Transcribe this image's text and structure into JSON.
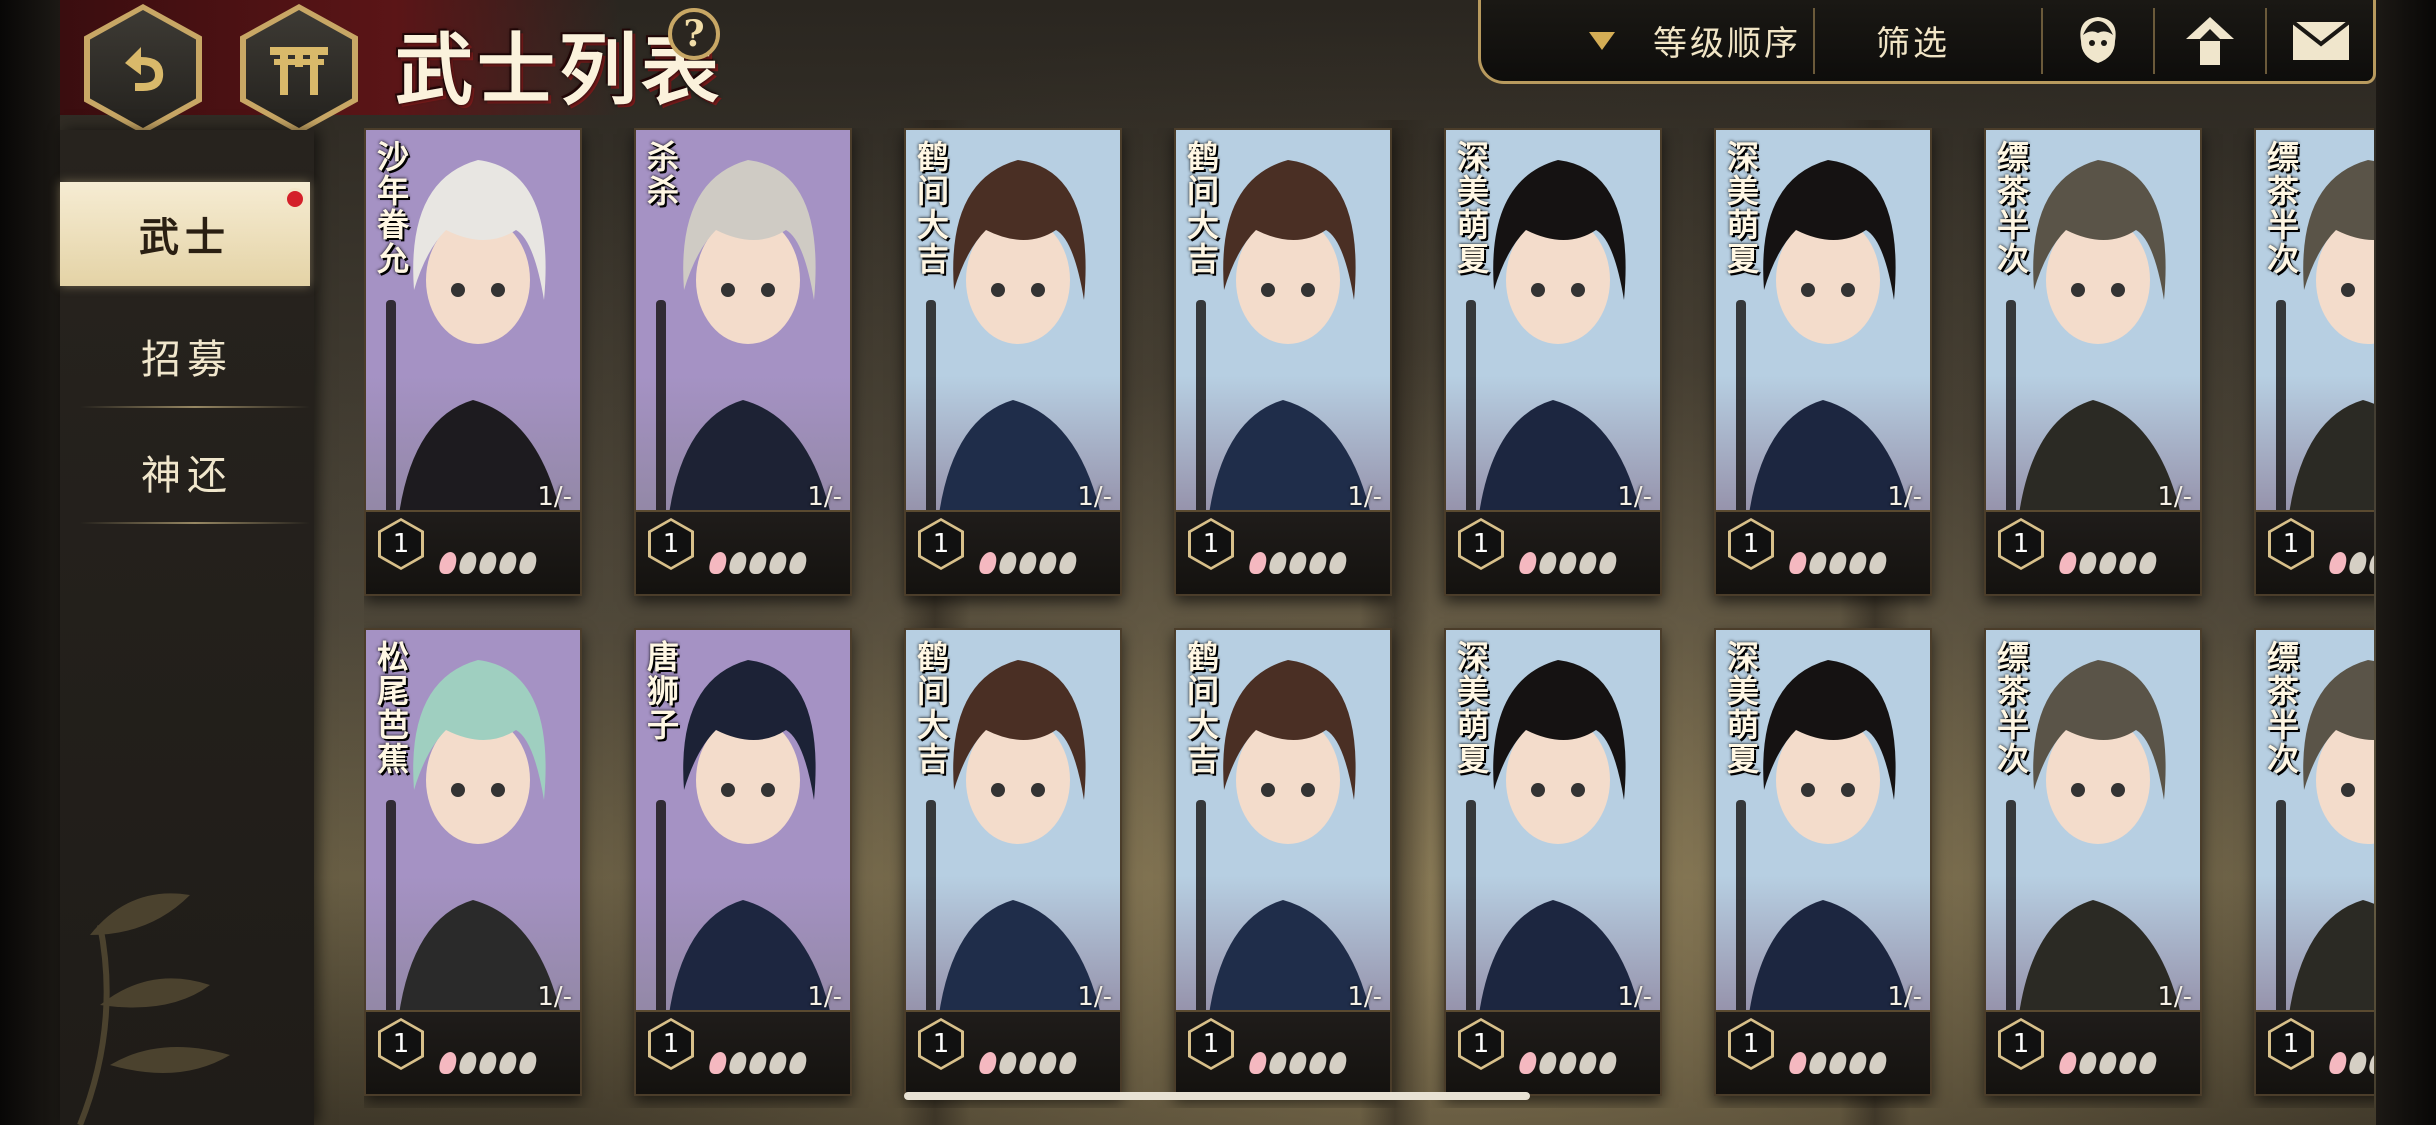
{
  "header": {
    "title": "武士列表",
    "back_icon": "back-arrow-icon",
    "home_icon": "torii-gate-icon",
    "help_label": "?"
  },
  "toolbar": {
    "sort_label": "等级顺序",
    "sort_icon": "dropdown-triangle-icon",
    "filter_label": "筛选",
    "icons": [
      "character-icon",
      "upgrade-arrow-icon",
      "mail-icon"
    ]
  },
  "sidebar": {
    "items": [
      {
        "label": "武士",
        "active": true,
        "badge": true
      },
      {
        "label": "招募",
        "active": false
      },
      {
        "label": "神还",
        "active": false
      }
    ]
  },
  "cards": [
    {
      "name": "沙年眷允",
      "level": "1",
      "count": "1/-",
      "theme": "purple"
    },
    {
      "name": "杀杀",
      "level": "1",
      "count": "1/-",
      "theme": "purple"
    },
    {
      "name": "鹤间大吉",
      "level": "1",
      "count": "1/-",
      "theme": "blue"
    },
    {
      "name": "鹤间大吉",
      "level": "1",
      "count": "1/-",
      "theme": "blue"
    },
    {
      "name": "深美萌夏",
      "level": "1",
      "count": "1/-",
      "theme": "blue"
    },
    {
      "name": "深美萌夏",
      "level": "1",
      "count": "1/-",
      "theme": "blue"
    },
    {
      "name": "缥茶半次",
      "level": "1",
      "count": "1/-",
      "theme": "blue"
    },
    {
      "name": "缥茶半次",
      "level": "1",
      "count": "",
      "theme": "blue"
    },
    {
      "name": "松尾芭蕉",
      "level": "1",
      "count": "1/-",
      "theme": "purple"
    },
    {
      "name": "唐狮子",
      "level": "1",
      "count": "1/-",
      "theme": "purple"
    },
    {
      "name": "鹤间大吉",
      "level": "1",
      "count": "1/-",
      "theme": "blue"
    },
    {
      "name": "鹤间大吉",
      "level": "1",
      "count": "1/-",
      "theme": "blue"
    },
    {
      "name": "深美萌夏",
      "level": "1",
      "count": "1/-",
      "theme": "blue"
    },
    {
      "name": "深美萌夏",
      "level": "1",
      "count": "1/-",
      "theme": "blue"
    },
    {
      "name": "缥茶半次",
      "level": "1",
      "count": "1/-",
      "theme": "blue"
    },
    {
      "name": "缥茶半次",
      "level": "1",
      "count": "",
      "theme": "blue"
    }
  ],
  "petals": {
    "total": 5,
    "filled": 1
  },
  "colors": {
    "purple": "#a592c4",
    "blue": "#b7cfe2",
    "gold": "#c8a765",
    "active_tab": "#efe2bd",
    "badge": "#d4202a"
  }
}
